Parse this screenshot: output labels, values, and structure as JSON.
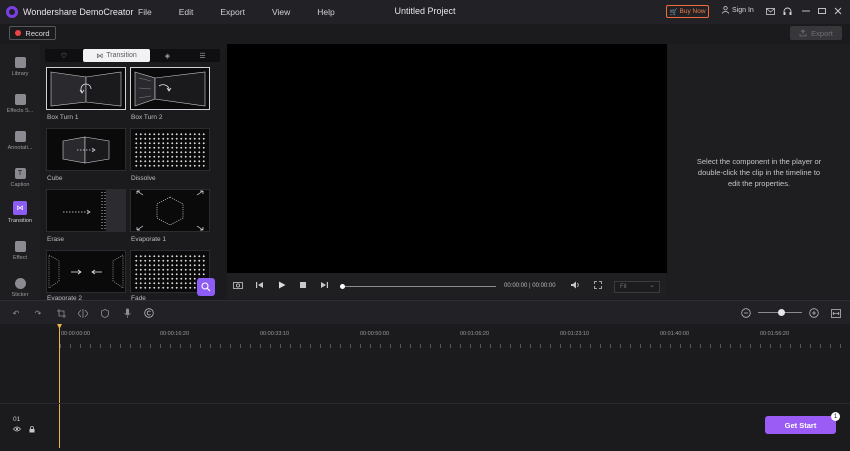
{
  "app": {
    "name": "Wondershare DemoCreator",
    "project_title": "Untitled Project",
    "menus": [
      "File",
      "Edit",
      "Export",
      "View",
      "Help"
    ],
    "buy_label": "Buy Now",
    "signin_label": "Sign In"
  },
  "toolbar": {
    "record_label": "Record",
    "export_label": "Export"
  },
  "rail": [
    {
      "label": "Library",
      "icon": "folder-icon"
    },
    {
      "label": "Effects S...",
      "icon": "effects-store-icon"
    },
    {
      "label": "Annotati...",
      "icon": "annotation-icon"
    },
    {
      "label": "Caption",
      "icon": "caption-icon"
    },
    {
      "label": "Transition",
      "icon": "transition-icon",
      "active": true
    },
    {
      "label": "Effect",
      "icon": "effect-wand-icon"
    },
    {
      "label": "Sticker",
      "icon": "sticker-icon"
    }
  ],
  "panel": {
    "tabs": [
      {
        "label": "",
        "icon": "heart-icon"
      },
      {
        "label": "Transition",
        "icon": "transition-icon",
        "active": true
      },
      {
        "label": "",
        "icon": "diamond-icon"
      },
      {
        "label": "",
        "icon": "list-icon"
      }
    ],
    "items": [
      {
        "label": "Box Turn 1"
      },
      {
        "label": "Box Turn 2"
      },
      {
        "label": "Cube"
      },
      {
        "label": "Dissolve"
      },
      {
        "label": "Erase"
      },
      {
        "label": "Evaporate 1"
      },
      {
        "label": "Evaporate 2"
      },
      {
        "label": "Fade"
      }
    ]
  },
  "player": {
    "timecode": "00:00:00 | 00:00:00",
    "fit_label": "Fit",
    "progress": 0
  },
  "properties": {
    "message": "Select the component in the player or\ndouble-click the clip in the timeline to\nedit the properties."
  },
  "timeline": {
    "ruler": [
      "00:00:00:00",
      "00:00:16:20",
      "00:00:33:10",
      "00:00:50:00",
      "00:01:06:20",
      "00:01:23:10",
      "00:01:40:00",
      "00:01:56:20"
    ],
    "track_number": "01",
    "get_start_label": "Get Start",
    "badge_count": "1"
  },
  "colors": {
    "accent": "#8c5cf5",
    "buy": "#f06b3a",
    "playhead": "#e8b14a",
    "record": "#f04444"
  }
}
